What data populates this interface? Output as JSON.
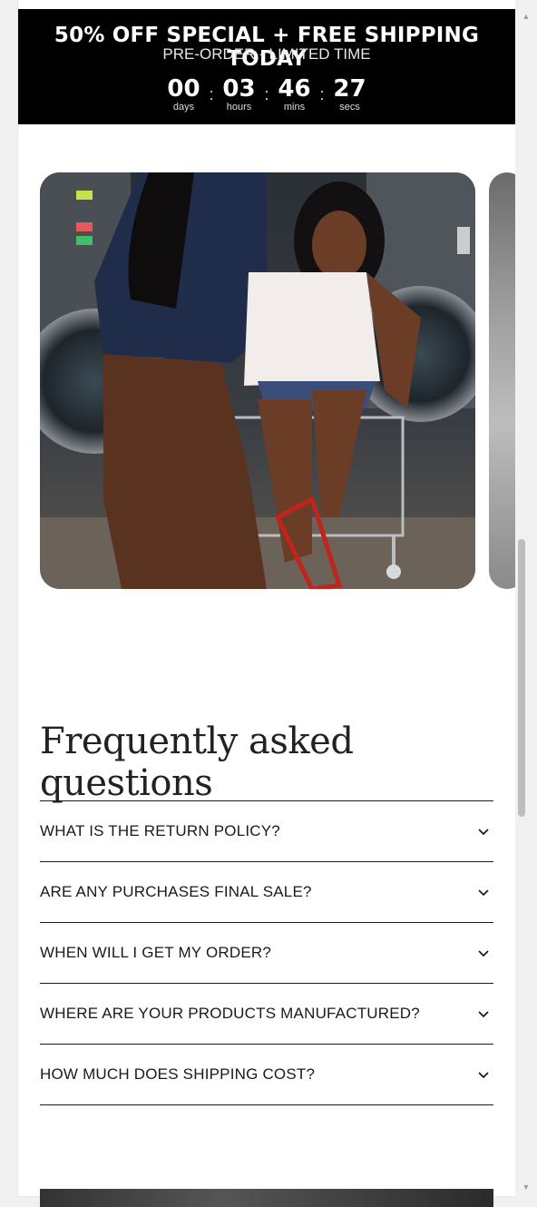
{
  "promo": {
    "title": "50% OFF SPECIAL + FREE SHIPPING TODAY",
    "subtitle": "PRE-ORDER - LIMITED TIME",
    "countdown": [
      {
        "value": "00",
        "label": "days"
      },
      {
        "value": "03",
        "label": "hours"
      },
      {
        "value": "46",
        "label": "mins"
      },
      {
        "value": "27",
        "label": "secs"
      }
    ],
    "separator": ":"
  },
  "faq": {
    "title": "Frequently asked questions",
    "items": [
      {
        "question": "WHAT IS THE RETURN POLICY?"
      },
      {
        "question": "ARE ANY PURCHASES FINAL SALE?"
      },
      {
        "question": "WHEN WILL I GET MY ORDER?"
      },
      {
        "question": "WHERE ARE YOUR PRODUCTS MANUFACTURED?"
      },
      {
        "question": "HOW MUCH DOES SHIPPING COST?"
      }
    ]
  },
  "icons": {
    "faq_toggle": "chevron-down-icon",
    "scroll_up": "scroll-up-arrow-icon",
    "scroll_down": "scroll-down-arrow-icon"
  },
  "colors": {
    "banner_bg": "#000000",
    "banner_text": "#ffffff",
    "page_bg": "#ffffff",
    "divider": "#1a1a1a"
  }
}
